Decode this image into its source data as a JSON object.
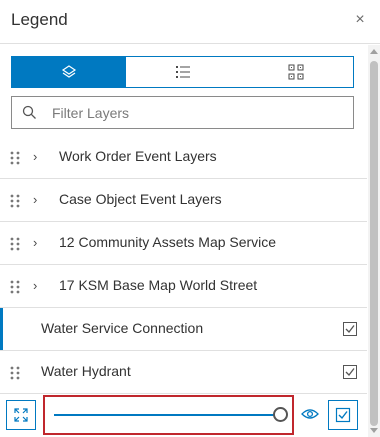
{
  "header": {
    "title": "Legend",
    "close_glyph": "×"
  },
  "view_toggle": {
    "options": [
      {
        "icon": "layers-icon",
        "active": true
      },
      {
        "icon": "list-icon",
        "active": false
      },
      {
        "icon": "grid-icon",
        "active": false
      }
    ]
  },
  "filter": {
    "placeholder": "Filter Layers",
    "value": ""
  },
  "layers": [
    {
      "label": "Work Order Event Layers",
      "group": true,
      "checked": null
    },
    {
      "label": "Case Object Event Layers",
      "group": true,
      "checked": null
    },
    {
      "label": "12 Community Assets Map Service",
      "group": true,
      "checked": null
    },
    {
      "label": "17 KSM Base Map World Street",
      "group": true,
      "checked": null
    },
    {
      "label": "Water Service Connection",
      "group": false,
      "checked": true,
      "selected": true
    },
    {
      "label": "Water Hydrant",
      "group": false,
      "checked": true,
      "selected": false
    }
  ],
  "toolbar": {
    "opacity_value": 1.0,
    "buttons": [
      "expand-icon",
      "eye-icon",
      "checkbox-icon"
    ]
  },
  "colors": {
    "accent": "#0079c1",
    "highlight_box": "#c0272d"
  }
}
